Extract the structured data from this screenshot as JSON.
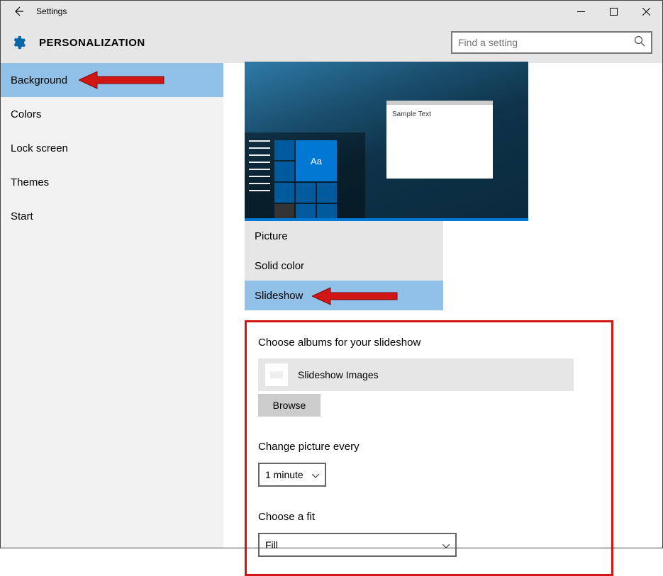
{
  "window": {
    "title": "Settings"
  },
  "header": {
    "breadcrumb": "PERSONALIZATION",
    "search_placeholder": "Find a setting"
  },
  "sidebar": {
    "items": [
      {
        "label": "Background",
        "selected": true
      },
      {
        "label": "Colors",
        "selected": false
      },
      {
        "label": "Lock screen",
        "selected": false
      },
      {
        "label": "Themes",
        "selected": false
      },
      {
        "label": "Start",
        "selected": false
      }
    ]
  },
  "preview": {
    "sample_text": "Sample Text",
    "tile_label": "Aa"
  },
  "background_dropdown": {
    "options": [
      {
        "label": "Picture",
        "selected": false
      },
      {
        "label": "Solid color",
        "selected": false
      },
      {
        "label": "Slideshow",
        "selected": true
      }
    ]
  },
  "slideshow": {
    "albums_label": "Choose albums for your slideshow",
    "album_name": "Slideshow Images",
    "browse_label": "Browse",
    "change_label": "Change picture every",
    "change_value": "1 minute",
    "fit_label": "Choose a fit",
    "fit_value": "Fill"
  }
}
